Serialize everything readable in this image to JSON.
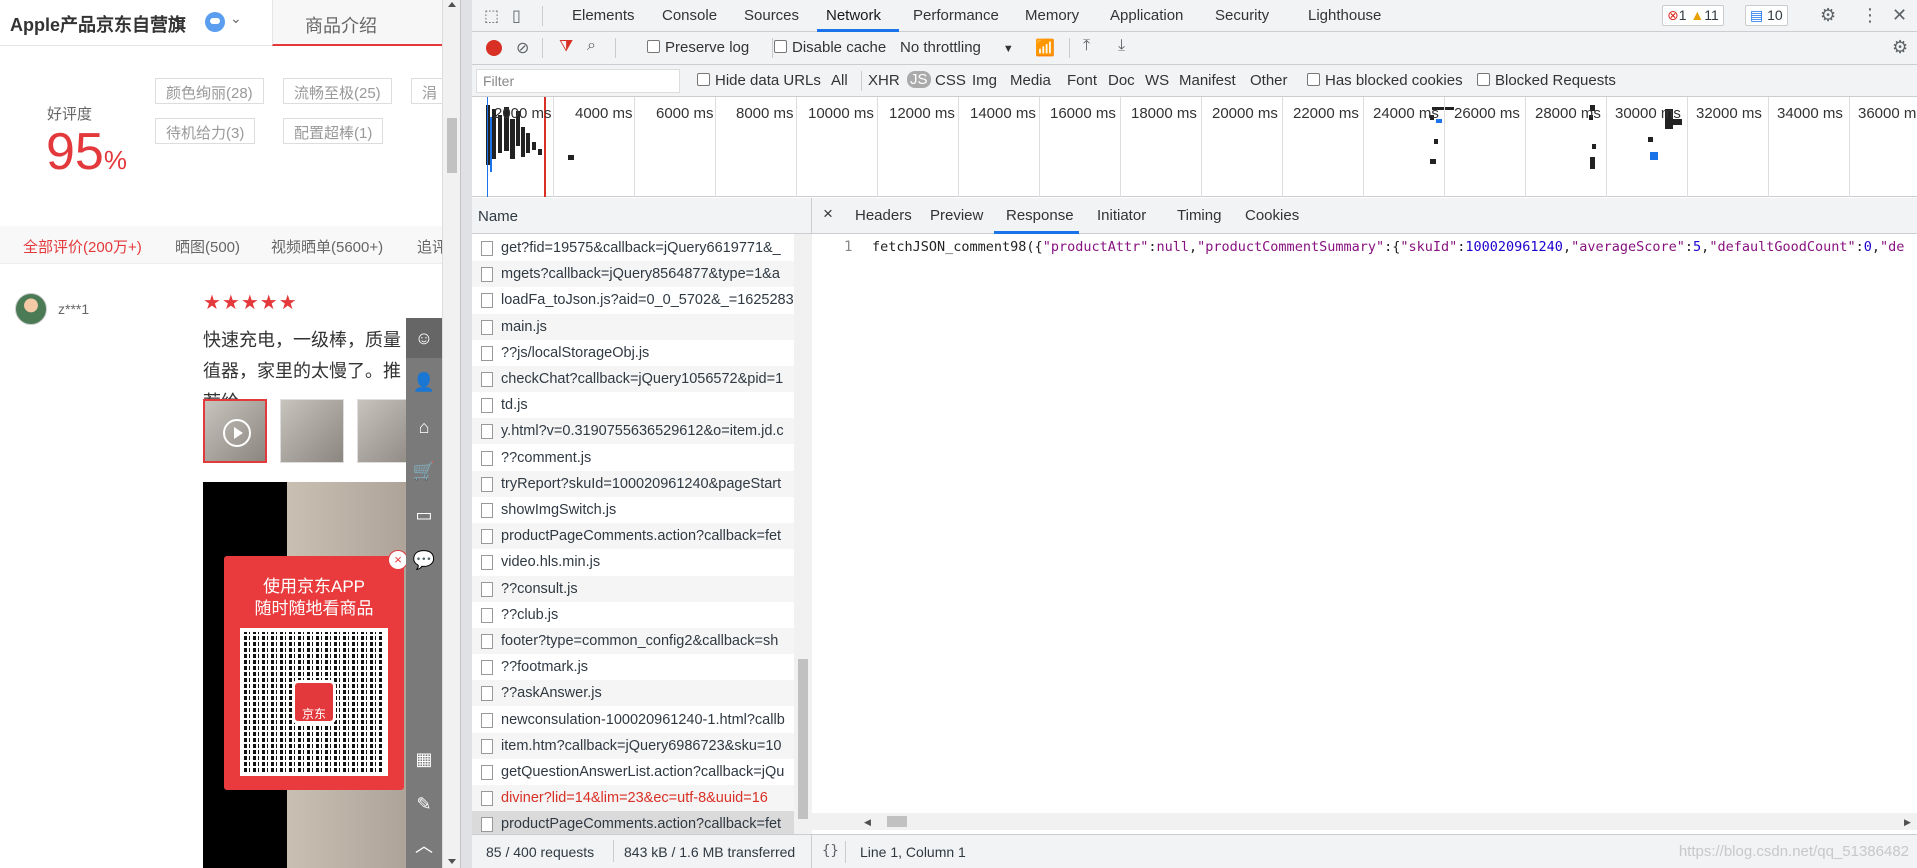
{
  "page": {
    "shop_name": "Apple产品京东自营旗",
    "tab_intro": "商品介绍",
    "rating_label": "好评度",
    "rating_value": "95",
    "rating_unit": "%",
    "tags": [
      "颜色绚丽(28)",
      "流畅至极(25)",
      "涓",
      "待机给力(3)",
      "配置超棒(1)"
    ],
    "filters": [
      "全部评价(200万+)",
      "晒图(500)",
      "视频晒单(5600+)",
      "追评"
    ],
    "review": {
      "user": "z***1",
      "stars": "★★★★★",
      "text": "快速充电，一级棒，质量徝器，家里的太慢了。推荐给"
    },
    "qr": {
      "title1": "使用京东APP",
      "title2": "随时随地看商品",
      "logo": "京东",
      "close": "×"
    },
    "side_icons": [
      "chat-icon",
      "user-icon",
      "feedback-icon",
      "cart-icon",
      "compare-icon",
      "message-icon",
      "qr-icon",
      "edit-icon",
      "top-icon"
    ]
  },
  "devtools": {
    "tabs": [
      "Elements",
      "Console",
      "Sources",
      "Network",
      "Performance",
      "Memory",
      "Application",
      "Security",
      "Lighthouse"
    ],
    "active_tab": "Network",
    "errors": "1",
    "warnings": "11",
    "messages": "10",
    "toolbar": {
      "preserve_log": "Preserve log",
      "disable_cache": "Disable cache",
      "throttling": "No throttling"
    },
    "filter": {
      "placeholder": "Filter",
      "hide_data_urls": "Hide data URLs",
      "types": [
        "All",
        "XHR",
        "JS",
        "CSS",
        "Img",
        "Media",
        "Font",
        "Doc",
        "WS",
        "Manifest",
        "Other"
      ],
      "active_type": "JS",
      "has_blocked_cookies": "Has blocked cookies",
      "blocked_requests": "Blocked Requests"
    },
    "overview_ticks": [
      "2000 ms",
      "4000 ms",
      "6000 ms",
      "8000 ms",
      "10000 ms",
      "12000 ms",
      "14000 ms",
      "16000 ms",
      "18000 ms",
      "20000 ms",
      "22000 ms",
      "24000 ms",
      "26000 ms",
      "28000 ms",
      "30000 ms",
      "32000 ms",
      "34000 ms",
      "36000 m"
    ],
    "name_header": "Name",
    "requests": [
      "get?fid=19575&callback=jQuery6619771&_",
      "mgets?callback=jQuery8564877&type=1&a",
      "loadFa_toJson.js?aid=0_0_5702&_=1625283",
      "main.js",
      "??js/localStorageObj.js",
      "checkChat?callback=jQuery1056572&pid=1",
      "td.js",
      "y.html?v=0.3190755636529612&o=item.jd.c",
      "??comment.js",
      "tryReport?skuId=100020961240&pageStart",
      "showImgSwitch.js",
      "productPageComments.action?callback=fet",
      "video.hls.min.js",
      "??consult.js",
      "??club.js",
      "footer?type=common_config2&callback=sh",
      "??footmark.js",
      "??askAnswer.js",
      "newconsulation-100020961240-1.html?callb",
      "item.htm?callback=jQuery6986723&sku=10",
      "getQuestionAnswerList.action?callback=jQu",
      "diviner?lid=14&lim=23&ec=utf-8&uuid=16",
      "productPageComments.action?callback=fet"
    ],
    "status_requests": "85 / 400 requests",
    "status_transferred": "843 kB / 1.6 MB transferred",
    "detail_tabs": [
      "Headers",
      "Preview",
      "Response",
      "Initiator",
      "Timing",
      "Cookies"
    ],
    "active_detail_tab": "Response",
    "response": {
      "line_number": "1",
      "fn": "fetchJSON_comment98({",
      "k1": "\"productAttr\"",
      "v1": "null",
      "k2": "\"productCommentSummary\"",
      "k3": "\"skuId\"",
      "v3": "100020961240",
      "k4": "\"averageScore\"",
      "v4": "5",
      "k5": "\"defaultGoodCount\"",
      "v5": "0",
      "tail": "\"de"
    },
    "cursor_pos": "Line 1, Column 1",
    "watermark": "https://blog.csdn.net/qq_51386482"
  }
}
